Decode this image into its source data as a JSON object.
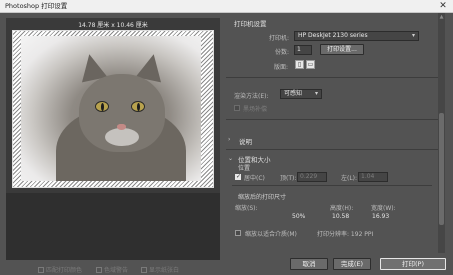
{
  "window": {
    "title": "Photoshop 打印设置",
    "close": "✕"
  },
  "preview": {
    "dimensions": "14.78 厘米 x 10.46 厘米"
  },
  "bottom_options": [
    {
      "label": "匹配打印颜色",
      "checked": false
    },
    {
      "label": "色域警告",
      "checked": false
    },
    {
      "label": "显示纸张白",
      "checked": false
    }
  ],
  "printer_setup": {
    "title": "打印机设置",
    "printer_label": "打印机:",
    "printer_value": "HP DeskJet 2130 series",
    "copies_label": "份数:",
    "copies_value": "1",
    "print_settings_button": "打印设置...",
    "layout_label": "版面:",
    "layout_icons": [
      "portrait-icon",
      "landscape-icon"
    ]
  },
  "color_management": {
    "rendering_label": "渲染方法(E):",
    "rendering_value": "可感知",
    "bpc_label": "黑场补偿"
  },
  "description": {
    "title": "说明"
  },
  "position_size": {
    "title": "位置和大小",
    "position_label": "位置",
    "center_label": "居中(C)",
    "center_checked": true,
    "top_label": "顶(T):",
    "top_value": "0.229",
    "left_label": "左(L):",
    "left_value": "1.04",
    "scaled_title": "缩放后的打印尺寸",
    "scale_label": "缩放(S):",
    "scale_value": "50%",
    "height_label": "高度(H):",
    "height_value": "10.58",
    "width_label": "宽度(W):",
    "width_value": "16.93",
    "fit_label": "缩放以适合介质(M)",
    "fit_checked": false,
    "resolution_text": "打印分辨率: 192 PPI"
  },
  "footer": {
    "cancel": "取消",
    "done": "完成(E)",
    "print": "打印(P)"
  },
  "colors": {
    "dialog_bg": "#535353",
    "preview_bg": "#3a3a3a",
    "titlebar_bg": "#f0f0f0"
  }
}
